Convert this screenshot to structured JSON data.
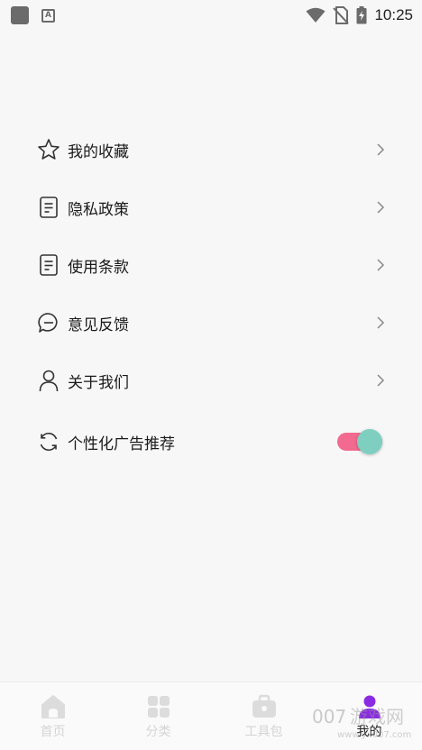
{
  "status_bar": {
    "time": "10:25",
    "icons": [
      "app-square-icon",
      "text-a-icon",
      "wifi-icon",
      "no-sim-icon",
      "battery-charging-icon"
    ]
  },
  "menu": {
    "items": [
      {
        "label": "我的收藏",
        "icon": "star-icon"
      },
      {
        "label": "隐私政策",
        "icon": "document-icon"
      },
      {
        "label": "使用条款",
        "icon": "document-icon"
      },
      {
        "label": "意见反馈",
        "icon": "chat-bubble-icon"
      },
      {
        "label": "关于我们",
        "icon": "person-icon"
      }
    ],
    "toggle_item": {
      "label": "个性化广告推荐",
      "icon": "refresh-icon",
      "enabled": true
    }
  },
  "colors": {
    "toggle_track": "#f26a8f",
    "toggle_knob": "#7ecfc0",
    "nav_inactive": "#d4d4d4",
    "nav_active_icon": "#8a2be2"
  },
  "bottom_nav": {
    "items": [
      {
        "label": "首页",
        "icon": "home-icon",
        "active": false
      },
      {
        "label": "分类",
        "icon": "grid-icon",
        "active": false
      },
      {
        "label": "工具包",
        "icon": "toolbox-icon",
        "active": false
      },
      {
        "label": "我的",
        "icon": "profile-icon",
        "active": true
      }
    ]
  }
}
